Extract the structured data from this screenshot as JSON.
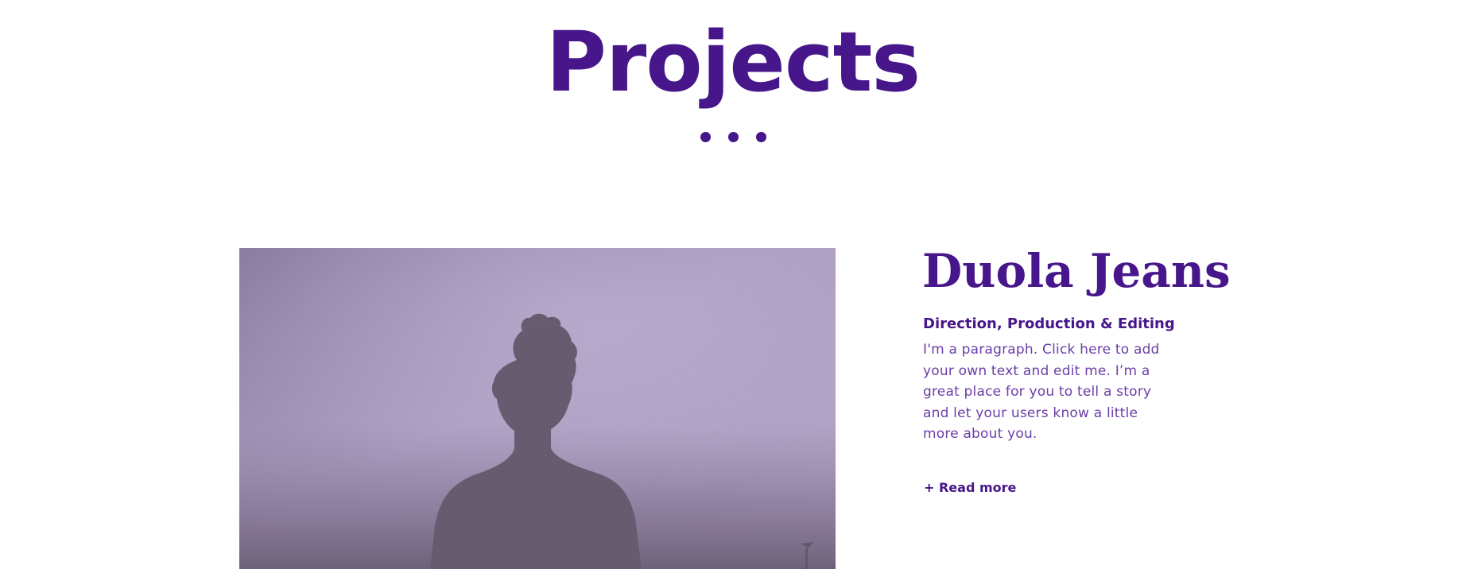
{
  "header": {
    "title": "Projects"
  },
  "project": {
    "title": "Duola Jeans",
    "subtitle": "Direction, Production & Editing",
    "description": "I'm a paragraph. Click here to add your own text and edit me. I’m a great place for you to tell a story and let your users know a little more about you.",
    "read_more_label": "+ Read more",
    "image_alt": "Silhouette of a person against a purple haze"
  },
  "colors": {
    "accent": "#46168a",
    "body_text": "#6b3ea8",
    "background": "#ffffff"
  },
  "icons": {
    "separator": "three-dots-icon"
  }
}
